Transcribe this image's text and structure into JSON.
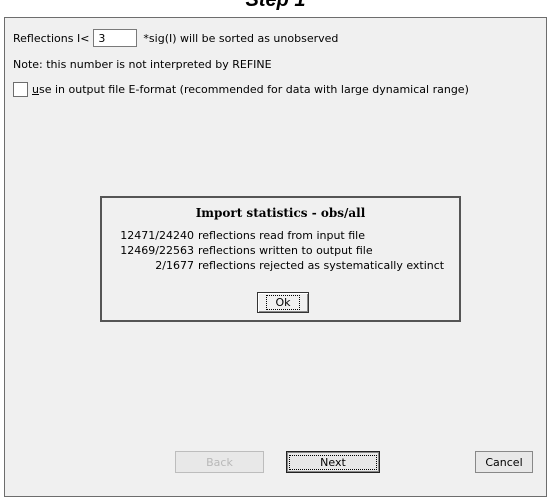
{
  "step_title": "Step 1",
  "reflections_row": {
    "prefix": "Reflections I<",
    "value": "3",
    "suffix": "*sig(I) will be sorted as unobserved"
  },
  "note": "Note: this number is not interpreted by REFINE",
  "checkbox": {
    "mnemonic": "u",
    "label_rest": "se in output file E-format (recommended for data with large dynamical range)",
    "checked": false
  },
  "dialog": {
    "title": "Import statistics - obs/all",
    "rows": [
      {
        "value": "12471/24240",
        "text": "reflections read from input file"
      },
      {
        "value": "12469/22563",
        "text": "reflections written to output file"
      },
      {
        "value": "2/1677",
        "text": "reflections rejected as systematically extinct"
      }
    ],
    "ok_label": "Ok"
  },
  "buttons": {
    "back": "Back",
    "next": "Next",
    "cancel": "Cancel"
  }
}
